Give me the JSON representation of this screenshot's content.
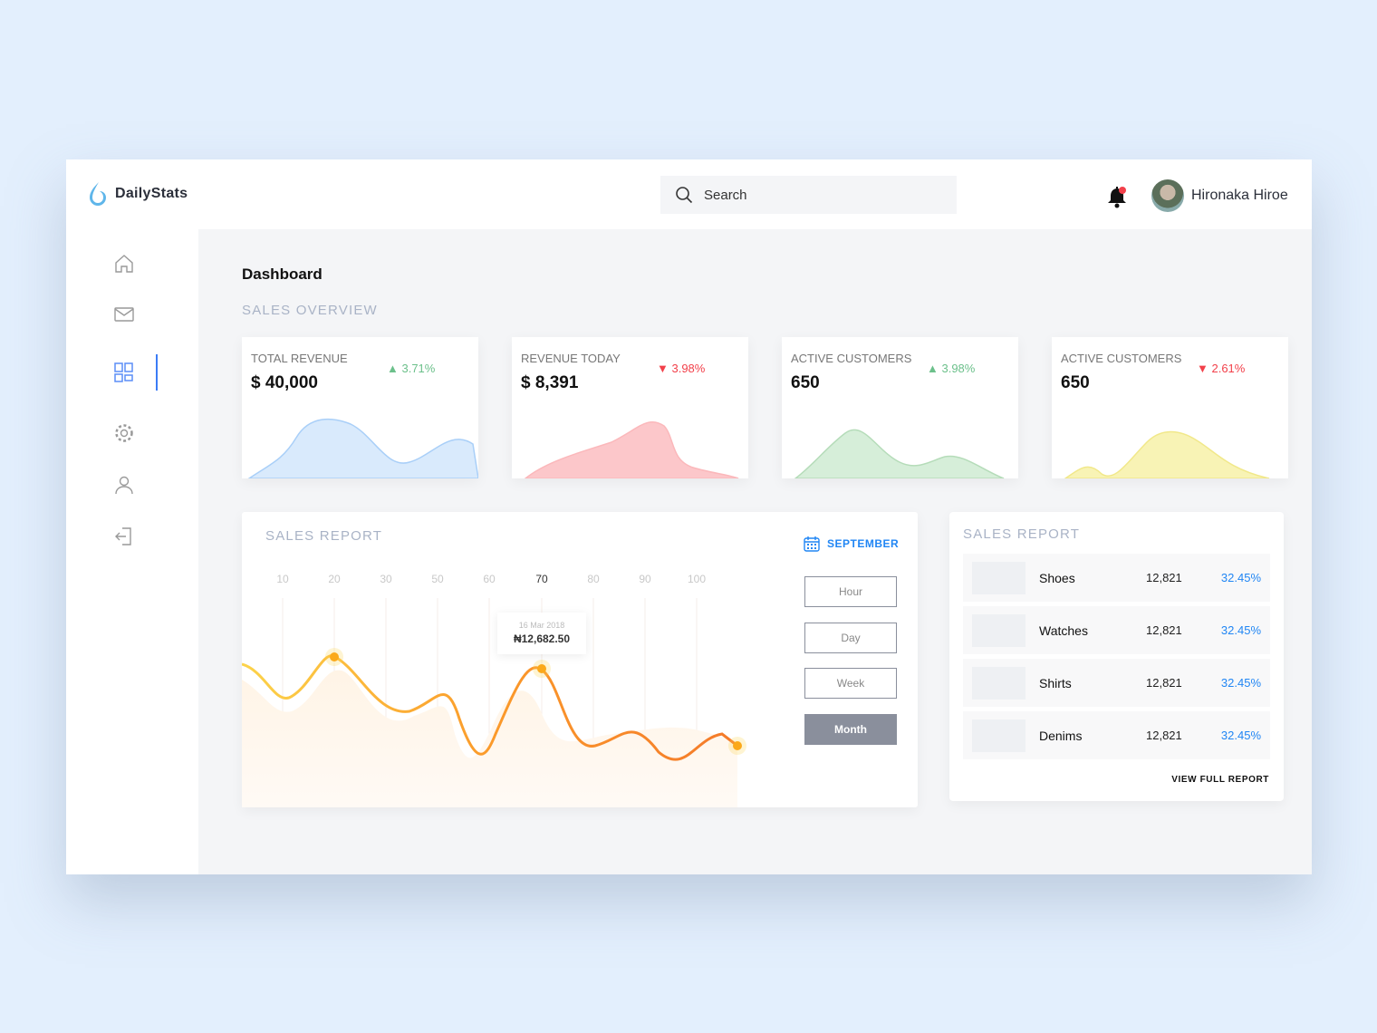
{
  "app": {
    "name": "DailyStats"
  },
  "search": {
    "placeholder": "Search"
  },
  "user": {
    "name": "Hironaka Hiroe"
  },
  "sidebar": {
    "items": [
      {
        "icon": "home-icon"
      },
      {
        "icon": "mail-icon"
      },
      {
        "icon": "dashboard-icon",
        "active": true
      },
      {
        "icon": "settings-icon"
      },
      {
        "icon": "user-icon"
      },
      {
        "icon": "logout-icon"
      }
    ]
  },
  "page": {
    "title": "Dashboard",
    "section": "SALES OVERVIEW"
  },
  "cards": [
    {
      "label": "TOTAL REVENUE",
      "value": "$ 40,000",
      "change": "3.71%",
      "trend": "up",
      "color": "#a9cff8"
    },
    {
      "label": "REVENUE TODAY",
      "value": "$ 8,391",
      "change": "3.98%",
      "trend": "down",
      "color": "#fbb8bb"
    },
    {
      "label": "ACTIVE CUSTOMERS",
      "value": "650",
      "change": "3.98%",
      "trend": "up",
      "color": "#c5e6c8"
    },
    {
      "label": "ACTIVE CUSTOMERS",
      "value": "650",
      "change": "2.61%",
      "trend": "down",
      "color": "#f6ef9e"
    }
  ],
  "colors": {
    "up": "#6cc08b",
    "down": "#f2404a",
    "accent": "#2186f4"
  },
  "sales_report": {
    "title": "SALES REPORT",
    "month": "SEPTEMBER",
    "ticks": [
      "10",
      "20",
      "30",
      "50",
      "60",
      "70",
      "80",
      "90",
      "100"
    ],
    "active_tick": "70",
    "tooltip": {
      "date": "16 Mar 2018",
      "value": "₦12,682.50"
    },
    "periods": [
      "Hour",
      "Day",
      "Week",
      "Month"
    ],
    "active_period": "Month"
  },
  "products": {
    "title": "SALES REPORT",
    "items": [
      {
        "name": "Shoes",
        "count": "12,821",
        "percent": "32.45%"
      },
      {
        "name": "Watches",
        "count": "12,821",
        "percent": "32.45%"
      },
      {
        "name": "Shirts",
        "count": "12,821",
        "percent": "32.45%"
      },
      {
        "name": "Denims",
        "count": "12,821",
        "percent": "32.45%"
      }
    ],
    "link": "VIEW FULL REPORT"
  }
}
